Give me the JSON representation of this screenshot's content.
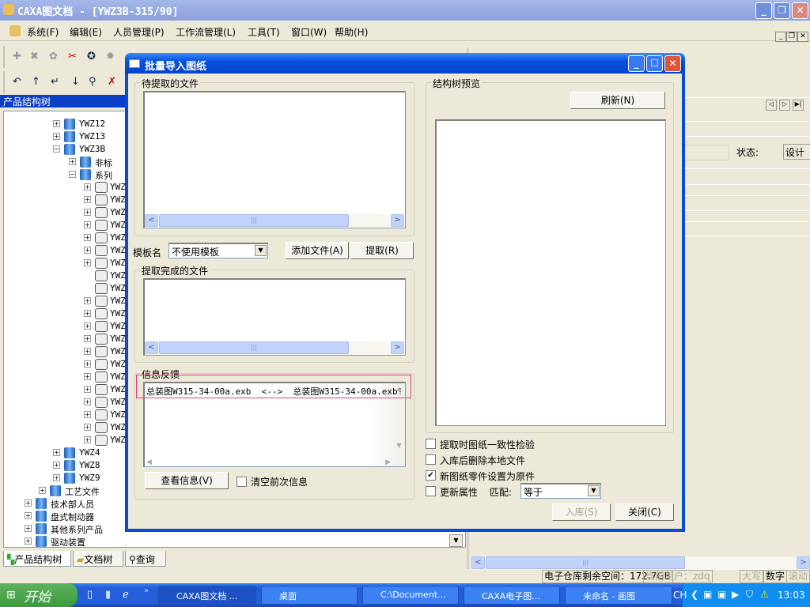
{
  "window": {
    "title": "CAXA图文档 - [YWZ3B-315/90]"
  },
  "menu": [
    "系统(F)",
    "编辑(E)",
    "人员管理(P)",
    "工作流管理(L)",
    "工具(T)",
    "窗口(W)",
    "帮助(H)"
  ],
  "left_panel": {
    "title": "产品结构树",
    "tabs": [
      "产品结构树",
      "文档树",
      "查询"
    ]
  },
  "tree": [
    {
      "label": "YWZ12",
      "level": 3,
      "exp": "+",
      "icon": "book"
    },
    {
      "label": "YWZ13",
      "level": 3,
      "exp": "+",
      "icon": "book"
    },
    {
      "label": "YWZ3B",
      "level": 3,
      "exp": "-",
      "icon": "book"
    },
    {
      "label": "非标",
      "level": 4,
      "exp": "+",
      "icon": "book"
    },
    {
      "label": "系列",
      "level": 4,
      "exp": "-",
      "icon": "book"
    },
    {
      "label": "YWZ",
      "level": 5,
      "exp": "+",
      "icon": "assembly"
    },
    {
      "label": "YWZ",
      "level": 5,
      "exp": "+",
      "icon": "assembly"
    },
    {
      "label": "YWZ",
      "level": 5,
      "exp": "+",
      "icon": "assembly"
    },
    {
      "label": "YWZ",
      "level": 5,
      "exp": "+",
      "icon": "assembly"
    },
    {
      "label": "YWZ",
      "level": 5,
      "exp": "+",
      "icon": "assembly"
    },
    {
      "label": "YWZ",
      "level": 5,
      "exp": "+",
      "icon": "assembly"
    },
    {
      "label": "YWZ",
      "level": 5,
      "exp": "+",
      "icon": "assembly"
    },
    {
      "label": "YWZ",
      "level": 5,
      "exp": "",
      "icon": "assembly"
    },
    {
      "label": "YWZ",
      "level": 5,
      "exp": "",
      "icon": "assembly"
    },
    {
      "label": "YWZ",
      "level": 5,
      "exp": "+",
      "icon": "assembly"
    },
    {
      "label": "YWZ",
      "level": 5,
      "exp": "+",
      "icon": "assembly"
    },
    {
      "label": "YWZ",
      "level": 5,
      "exp": "+",
      "icon": "assembly"
    },
    {
      "label": "YWZ",
      "level": 5,
      "exp": "+",
      "icon": "assembly"
    },
    {
      "label": "YWZ",
      "level": 5,
      "exp": "+",
      "icon": "assembly"
    },
    {
      "label": "YWZ",
      "level": 5,
      "exp": "+",
      "icon": "assembly"
    },
    {
      "label": "YWZ",
      "level": 5,
      "exp": "+",
      "icon": "assembly"
    },
    {
      "label": "YWZ",
      "level": 5,
      "exp": "+",
      "icon": "assembly"
    },
    {
      "label": "YWZ",
      "level": 5,
      "exp": "+",
      "icon": "assembly"
    },
    {
      "label": "YWZ",
      "level": 5,
      "exp": "+",
      "icon": "assembly"
    },
    {
      "label": "YWZ",
      "level": 5,
      "exp": "+",
      "icon": "assembly"
    },
    {
      "label": "YWZ",
      "level": 5,
      "exp": "+",
      "icon": "assembly"
    },
    {
      "label": "YWZ4",
      "level": 3,
      "exp": "+",
      "icon": "book"
    },
    {
      "label": "YWZ8",
      "level": 3,
      "exp": "+",
      "icon": "book"
    },
    {
      "label": "YWZ9",
      "level": 3,
      "exp": "+",
      "icon": "book"
    },
    {
      "label": "工艺文件",
      "level": 2,
      "exp": "+",
      "icon": "book"
    },
    {
      "label": "技术部人员",
      "level": 1,
      "exp": "+",
      "icon": "book"
    },
    {
      "label": "盘式制动器",
      "level": 1,
      "exp": "+",
      "icon": "book"
    },
    {
      "label": "其他系列产品",
      "level": 1,
      "exp": "+",
      "icon": "book"
    },
    {
      "label": "驱动装置",
      "level": 1,
      "exp": "+",
      "icon": "book"
    }
  ],
  "dialog": {
    "title": "批量导入图纸",
    "pending_group": "待提取的文件",
    "template_label": "模板名",
    "template_value": "不使用模板",
    "add_file": "添加文件(A)",
    "extract": "提取(R)",
    "done_group": "提取完成的文件",
    "info_group": "信息反馈",
    "info_line": "总装图W315-34-00a.exb  <-->  总装图W315-34-00a.exb!",
    "view_info": "查看信息(V)",
    "clear_prev": "清空前次信息",
    "preview_group": "结构树预览",
    "refresh": "刷新(N)",
    "options": [
      {
        "label": "提取时图纸一致性检验",
        "checked": false
      },
      {
        "label": "入库后删除本地文件",
        "checked": false
      },
      {
        "label": "新图纸零件设置为原件",
        "checked": true
      },
      {
        "label": "更新属性",
        "checked": false
      }
    ],
    "match_label": "匹配:",
    "match_value": "等于",
    "store": "入库(S)",
    "close": "关闭(C)"
  },
  "right_panel": {
    "status_label": "状态:",
    "status_value": "设计"
  },
  "statusbar": {
    "space": "电子仓库剩余空间：172.7GB",
    "user": "当前用户：zdq",
    "caps": "大写",
    "num": "数字",
    "scroll": "滚动"
  },
  "taskbar": {
    "start": "开始",
    "tasks": [
      "CAXA图文档 ...",
      "桌面",
      "C:\\Document...",
      "CAXA电子图...",
      "未命名 - 画图"
    ],
    "lang": "CH",
    "clock": "13:03"
  }
}
